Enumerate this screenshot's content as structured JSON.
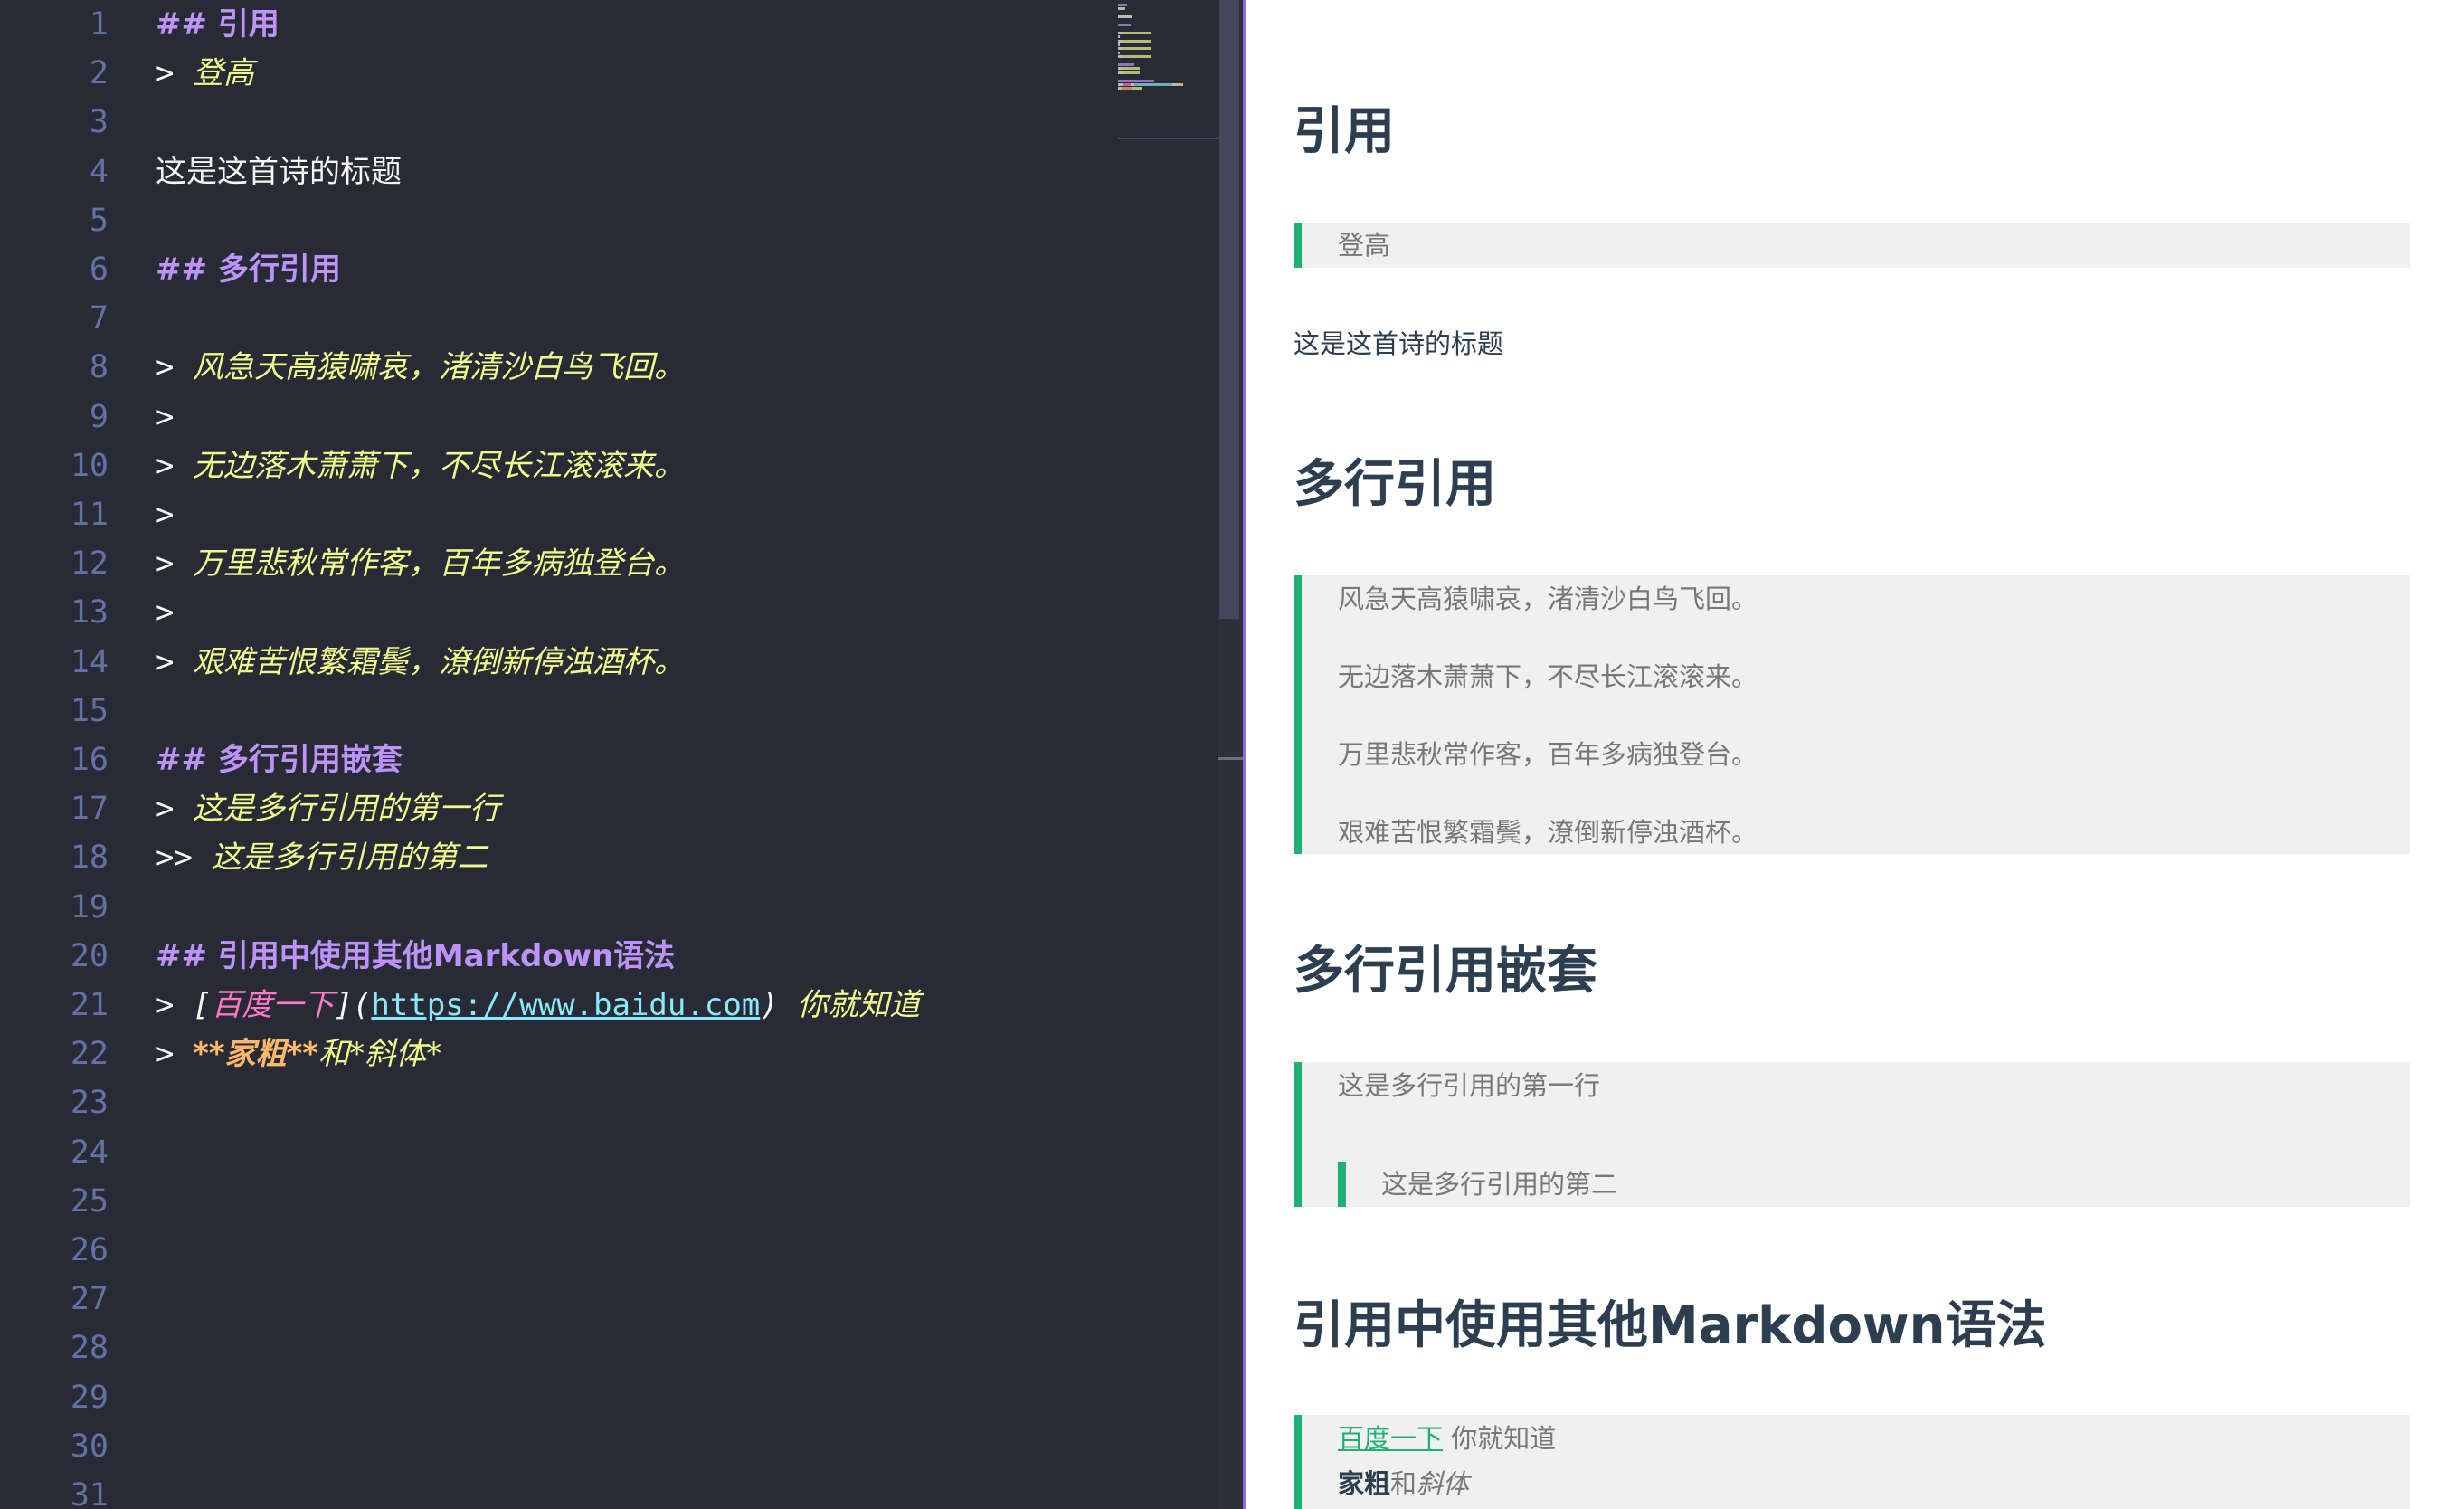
{
  "editor": {
    "lines": [
      {
        "n": "1",
        "tokens": [
          {
            "c": "t-head",
            "t": "## 引用"
          }
        ]
      },
      {
        "n": "2",
        "tokens": [
          {
            "c": "t-marker",
            "t": "> "
          },
          {
            "c": "t-quote",
            "t": "登高"
          }
        ]
      },
      {
        "n": "3",
        "tokens": []
      },
      {
        "n": "4",
        "tokens": [
          {
            "c": "t-text",
            "t": "这是这首诗的标题"
          }
        ]
      },
      {
        "n": "5",
        "tokens": []
      },
      {
        "n": "6",
        "tokens": [
          {
            "c": "t-head",
            "t": "## 多行引用"
          }
        ]
      },
      {
        "n": "7",
        "tokens": []
      },
      {
        "n": "8",
        "tokens": [
          {
            "c": "t-marker",
            "t": "> "
          },
          {
            "c": "t-quote",
            "t": "风急天高猿啸哀，渚清沙白鸟飞回。"
          }
        ]
      },
      {
        "n": "9",
        "tokens": [
          {
            "c": "t-marker",
            "t": ">"
          }
        ]
      },
      {
        "n": "10",
        "tokens": [
          {
            "c": "t-marker",
            "t": "> "
          },
          {
            "c": "t-quote",
            "t": "无边落木萧萧下，不尽长江滚滚来。"
          }
        ]
      },
      {
        "n": "11",
        "tokens": [
          {
            "c": "t-marker",
            "t": ">"
          }
        ]
      },
      {
        "n": "12",
        "tokens": [
          {
            "c": "t-marker",
            "t": "> "
          },
          {
            "c": "t-quote",
            "t": "万里悲秋常作客，百年多病独登台。"
          }
        ]
      },
      {
        "n": "13",
        "tokens": [
          {
            "c": "t-marker",
            "t": ">"
          }
        ]
      },
      {
        "n": "14",
        "tokens": [
          {
            "c": "t-marker",
            "t": "> "
          },
          {
            "c": "t-quote",
            "t": "艰难苦恨繁霜鬓，潦倒新停浊酒杯。"
          }
        ]
      },
      {
        "n": "15",
        "tokens": []
      },
      {
        "n": "16",
        "tokens": [
          {
            "c": "t-head",
            "t": "## 多行引用嵌套"
          }
        ]
      },
      {
        "n": "17",
        "tokens": [
          {
            "c": "t-marker",
            "t": "> "
          },
          {
            "c": "t-quote",
            "t": "这是多行引用的第一行"
          }
        ]
      },
      {
        "n": "18",
        "tokens": [
          {
            "c": "t-marker",
            "t": ">> "
          },
          {
            "c": "t-quote",
            "t": "这是多行引用的第二"
          }
        ]
      },
      {
        "n": "19",
        "tokens": []
      },
      {
        "n": "20",
        "tokens": [
          {
            "c": "t-head",
            "t": "## 引用中使用其他Markdown语法"
          }
        ]
      },
      {
        "n": "21",
        "tokens": [
          {
            "c": "t-marker",
            "t": "> "
          },
          {
            "c": "t-bracket",
            "t": "["
          },
          {
            "c": "t-linktext",
            "t": "百度一下"
          },
          {
            "c": "t-bracket",
            "t": "]("
          },
          {
            "c": "t-url",
            "t": "https://www.baidu.com"
          },
          {
            "c": "t-bracket",
            "t": ") "
          },
          {
            "c": "t-quote",
            "t": "你就知道"
          }
        ]
      },
      {
        "n": "22",
        "tokens": [
          {
            "c": "t-marker",
            "t": "> "
          },
          {
            "c": "t-bold",
            "t": "**家粗**"
          },
          {
            "c": "t-quote",
            "t": "和*斜体*"
          }
        ]
      },
      {
        "n": "23",
        "tokens": []
      },
      {
        "n": "24",
        "tokens": []
      },
      {
        "n": "25",
        "tokens": []
      },
      {
        "n": "26",
        "tokens": []
      },
      {
        "n": "27",
        "tokens": []
      },
      {
        "n": "28",
        "tokens": []
      },
      {
        "n": "29",
        "tokens": []
      },
      {
        "n": "30",
        "tokens": []
      },
      {
        "n": "31",
        "tokens": []
      }
    ]
  },
  "preview": {
    "h_quote": "引用",
    "bq_single": "登高",
    "para_title": "这是这首诗的标题",
    "h_multi": "多行引用",
    "bq_multi": [
      "风急天高猿啸哀，渚清沙白鸟飞回。",
      "无边落木萧萧下，不尽长江滚滚来。",
      "万里悲秋常作客，百年多病独登台。",
      "艰难苦恨繁霜鬓，潦倒新停浊酒杯。"
    ],
    "h_nested": "多行引用嵌套",
    "bq_nested_1": "这是多行引用的第一行",
    "bq_nested_2": "这是多行引用的第二",
    "h_other": "引用中使用其他Markdown语法",
    "link_text": "百度一下",
    "after_link": " 你就知道",
    "strong_text": "家粗",
    "and_text": "和",
    "em_text": "斜体"
  },
  "colors": {
    "editor_bg": "#282a36",
    "accent_divider": "#8f6ddf",
    "quote_border": "#20b070",
    "heading": "#2c3e50"
  }
}
